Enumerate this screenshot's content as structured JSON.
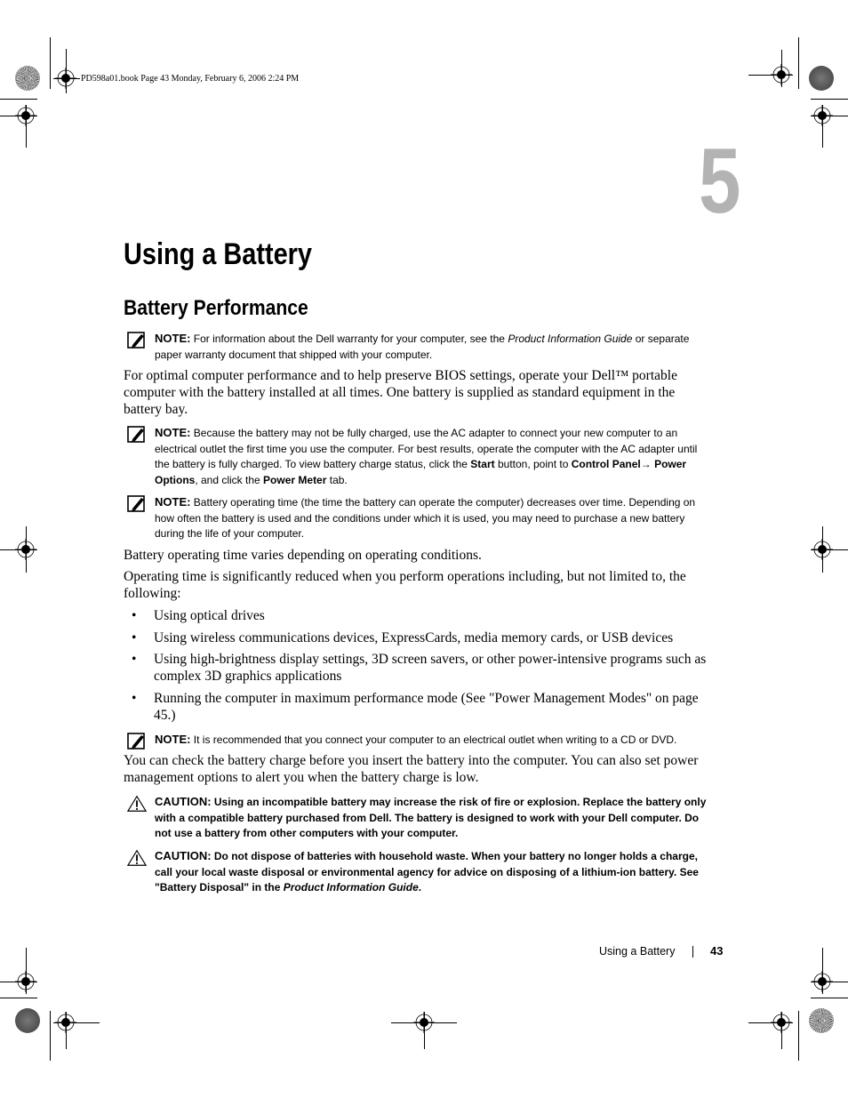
{
  "print_slug": "PD598a01.book  Page 43  Monday, February 6, 2006  2:24 PM",
  "chapter": {
    "number": "5",
    "title": "Using a Battery"
  },
  "section": {
    "title": "Battery Performance"
  },
  "notes": [
    {
      "label": "NOTE:",
      "icon": "pencil-note-icon",
      "parts": [
        {
          "t": "For information about the Dell warranty for your computer, see the ",
          "s": "normal"
        },
        {
          "t": "Product Information Guide",
          "s": "italic"
        },
        {
          "t": " or separate paper warranty document that shipped with your computer.",
          "s": "normal"
        }
      ]
    },
    {
      "label": "NOTE:",
      "icon": "pencil-note-icon",
      "parts": [
        {
          "t": "Because the battery may not be fully charged, use the AC adapter to connect your new computer to an electrical outlet the first time you use the computer. For best results, operate the computer with the AC adapter until the battery is fully charged. To view battery charge status, click the ",
          "s": "normal"
        },
        {
          "t": "Start",
          "s": "bold"
        },
        {
          "t": " button, point to ",
          "s": "normal"
        },
        {
          "t": "Control Panel",
          "s": "bold"
        },
        {
          "t": "→ ",
          "s": "normal"
        },
        {
          "t": "Power Options",
          "s": "bold"
        },
        {
          "t": ", and click the ",
          "s": "normal"
        },
        {
          "t": "Power Meter",
          "s": "bold"
        },
        {
          "t": " tab.",
          "s": "normal"
        }
      ]
    },
    {
      "label": "NOTE:",
      "icon": "pencil-note-icon",
      "parts": [
        {
          "t": "Battery operating time (the time the battery can operate the computer) decreases over time. Depending on how often the battery is used and the conditions under which it is used, you may need to purchase a new battery during the life of your computer.",
          "s": "normal"
        }
      ]
    },
    {
      "label": "NOTE:",
      "icon": "pencil-note-icon",
      "parts": [
        {
          "t": "It is recommended that you connect your computer to an electrical outlet when writing to a CD or DVD.",
          "s": "normal"
        }
      ]
    }
  ],
  "paragraphs": {
    "intro": "For optimal computer performance and to help preserve BIOS settings, operate your Dell™ portable computer with the battery installed at all times. One battery is supplied as standard equipment in the battery bay.",
    "varies": "Battery operating time varies depending on operating conditions.",
    "reduced": "Operating time is significantly reduced when you perform operations including, but not limited to, the following:",
    "check": "You can check the battery charge before you insert the battery into the computer. You can also set power management options to alert you when the battery charge is low."
  },
  "bullets": [
    "Using optical drives",
    "Using wireless communications devices, ExpressCards, media memory cards, or USB devices",
    "Using high-brightness display settings, 3D screen savers, or other power-intensive programs such as complex 3D graphics applications",
    "Running the computer in maximum performance mode (See \"Power Management Modes\" on page 45.)"
  ],
  "bullet_glyph": "•",
  "cautions": [
    {
      "label": "CAUTION:",
      "icon": "warning-triangle-icon",
      "parts": [
        {
          "t": "Using an incompatible battery may increase the risk of fire or explosion. Replace the battery only with a compatible battery purchased from Dell. The battery is designed to work with your Dell computer. Do not use a battery from other computers with your computer.",
          "s": "bold"
        }
      ]
    },
    {
      "label": "CAUTION:",
      "icon": "warning-triangle-icon",
      "parts": [
        {
          "t": "Do not dispose of batteries with household waste. When your battery no longer holds a charge, call your local waste disposal or environmental agency for advice on disposing of a lithium-ion battery. See \"Battery Disposal\" in the ",
          "s": "bold"
        },
        {
          "t": "Product Information Guide",
          "s": "bolditalic"
        },
        {
          "t": ".",
          "s": "bold"
        }
      ]
    }
  ],
  "footer": {
    "running_title": "Using a Battery",
    "page_number": "43"
  },
  "colors": {
    "chapter_number": "#b3b3b3",
    "text": "#000000"
  }
}
